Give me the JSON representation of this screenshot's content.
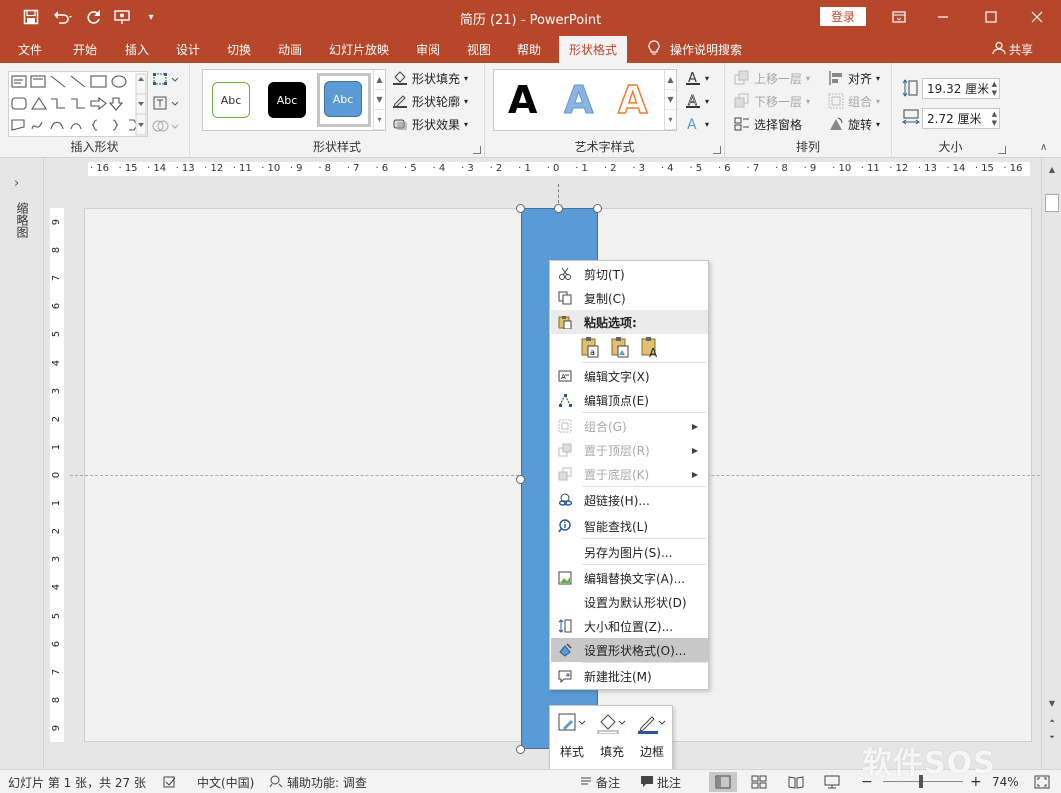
{
  "titlebar": {
    "title": "简历 (21)  -  PowerPoint",
    "login_label": "登录",
    "icons": [
      "save-icon",
      "undo-icon",
      "redo-icon",
      "present-icon",
      "customize-icon"
    ]
  },
  "tabs": [
    "文件",
    "开始",
    "插入",
    "设计",
    "切换",
    "动画",
    "幻灯片放映",
    "审阅",
    "视图",
    "帮助",
    "形状格式"
  ],
  "active_tab": "形状格式",
  "tell_me": "操作说明搜索",
  "share": "共享",
  "ribbon": {
    "insert_shapes": {
      "label": "插入形状"
    },
    "shape_styles": {
      "label": "形状样式",
      "style_samples": [
        "Abc",
        "Abc",
        "Abc"
      ],
      "fill": "形状填充",
      "outline": "形状轮廓",
      "effects": "形状效果"
    },
    "wordart": {
      "label": "艺术字样式",
      "samples": [
        "A",
        "A",
        "A"
      ]
    },
    "arrange": {
      "label": "排列",
      "bring_forward": "上移一层",
      "send_backward": "下移一层",
      "selection_pane": "选择窗格",
      "align": "对齐",
      "group": "组合",
      "rotate": "旋转"
    },
    "size": {
      "label": "大小",
      "height": "19.32 厘米",
      "width": "2.72 厘米"
    }
  },
  "left_panel": {
    "label": "缩略图"
  },
  "ruler_h": [
    "16",
    "15",
    "14",
    "13",
    "12",
    "11",
    "10",
    "9",
    "8",
    "7",
    "6",
    "5",
    "4",
    "3",
    "2",
    "1",
    "0",
    "1",
    "2",
    "3",
    "4",
    "5",
    "6",
    "7",
    "8",
    "9",
    "10",
    "11",
    "12",
    "13",
    "14",
    "15",
    "16"
  ],
  "ruler_v": [
    "9",
    "8",
    "7",
    "6",
    "5",
    "4",
    "3",
    "2",
    "1",
    "0",
    "1",
    "2",
    "3",
    "4",
    "5",
    "6",
    "7",
    "8",
    "9"
  ],
  "context_menu": {
    "items": [
      {
        "label": "剪切(T)",
        "icon": "scissors-icon",
        "state": "normal"
      },
      {
        "label": "复制(C)",
        "icon": "copy-icon",
        "state": "normal"
      },
      {
        "label": "粘贴选项:",
        "icon": "paste-icon",
        "state": "header"
      },
      {
        "label": "编辑文字(X)",
        "icon": "edit-text-icon",
        "state": "normal"
      },
      {
        "label": "编辑顶点(E)",
        "icon": "edit-points-icon",
        "state": "normal"
      },
      {
        "label": "组合(G)",
        "icon": "group-icon",
        "state": "disabled",
        "submenu": true
      },
      {
        "label": "置于顶层(R)",
        "icon": "bring-front-icon",
        "state": "disabled",
        "submenu": true
      },
      {
        "label": "置于底层(K)",
        "icon": "send-back-icon",
        "state": "disabled",
        "submenu": true
      },
      {
        "label": "超链接(H)...",
        "icon": "link-icon",
        "state": "normal"
      },
      {
        "label": "智能查找(L)",
        "icon": "smart-lookup-icon",
        "state": "normal"
      },
      {
        "label": "另存为图片(S)...",
        "icon": "",
        "state": "normal"
      },
      {
        "label": "编辑替换文字(A)...",
        "icon": "alt-text-icon",
        "state": "normal"
      },
      {
        "label": "设置为默认形状(D)",
        "icon": "",
        "state": "normal"
      },
      {
        "label": "大小和位置(Z)...",
        "icon": "size-position-icon",
        "state": "normal"
      },
      {
        "label": "设置形状格式(O)...",
        "icon": "format-shape-icon",
        "state": "highlighted"
      },
      {
        "label": "新建批注(M)",
        "icon": "comment-icon",
        "state": "normal"
      }
    ]
  },
  "mini_toolbar": {
    "style": "样式",
    "fill": "填充",
    "border": "边框"
  },
  "status": {
    "slide_info": "幻灯片 第 1 张，共 27 张",
    "language": "中文(中国)",
    "accessibility": "辅助功能: 调查",
    "notes": "备注",
    "comments": "批注",
    "zoom": "74%"
  },
  "watermark": "软件SOS"
}
